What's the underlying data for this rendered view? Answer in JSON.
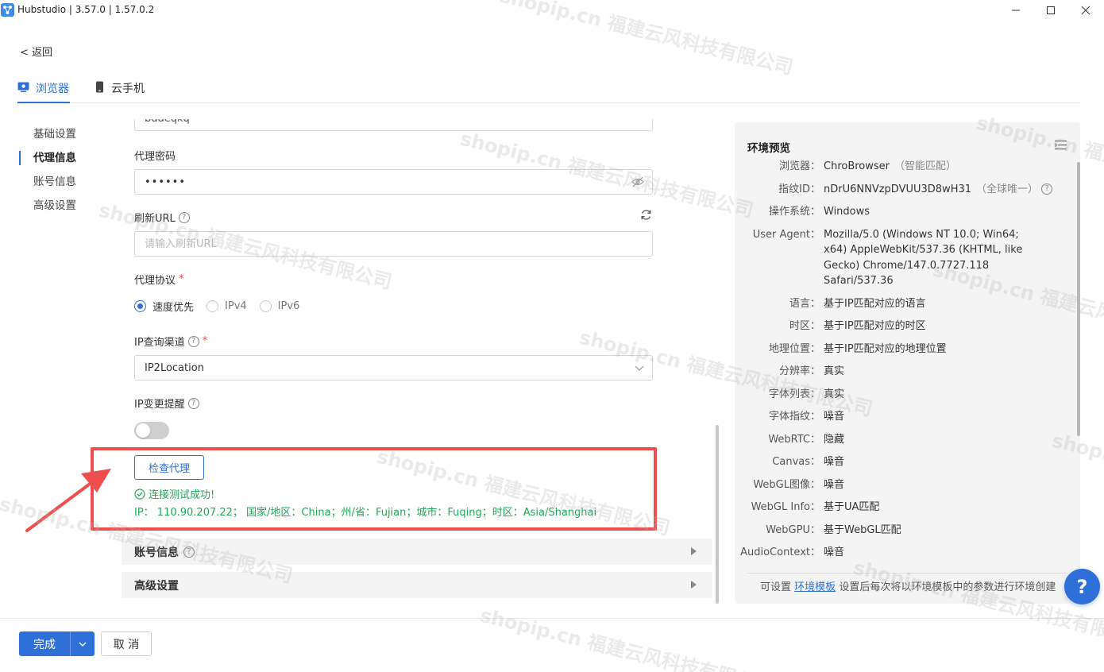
{
  "window": {
    "title": "Hubstudio | 3.57.0 | 1.57.0.2",
    "controls": [
      "minimize-icon",
      "maximize-icon",
      "close-icon"
    ]
  },
  "nav": {
    "back_label": "< 返回"
  },
  "tabs": [
    {
      "label": "浏览器",
      "icon": "browser-icon",
      "active": true
    },
    {
      "label": "云手机",
      "icon": "phone-icon",
      "active": false
    }
  ],
  "subnav": {
    "items": [
      {
        "label": "基础设置",
        "active": false
      },
      {
        "label": "代理信息",
        "active": true
      },
      {
        "label": "账号信息",
        "active": false
      },
      {
        "label": "高级设置",
        "active": false
      }
    ]
  },
  "form": {
    "username_partial": "bddeqkq",
    "proxy_password": {
      "label": "代理密码",
      "value": "••••••"
    },
    "refresh_url": {
      "label": "刷新URL",
      "placeholder": "请输入刷新URL"
    },
    "protocol": {
      "label": "代理协议",
      "required_mark": "*",
      "options": [
        {
          "label": "速度优先",
          "selected": true
        },
        {
          "label": "IPv4",
          "selected": false
        },
        {
          "label": "IPv6",
          "selected": false
        }
      ]
    },
    "ip_channel": {
      "label": "IP查询渠道",
      "required_mark": "*",
      "value": "IP2Location"
    },
    "ip_change_alert": {
      "label": "IP变更提醒",
      "enabled": false
    },
    "check_button_label": "检查代理",
    "success_text": "连接测试成功!",
    "ip_info": "IP： 110.90.207.22； 国家/地区：China；州/省：Fujian；城市：Fuqing；时区：Asia/Shanghai",
    "collapsed_sections": [
      {
        "label": "账号信息",
        "has_help": true
      },
      {
        "label": "高级设置",
        "has_help": false
      }
    ]
  },
  "env_preview": {
    "title": "环境预览",
    "rows": [
      {
        "label": "浏览器：",
        "value": "ChroBrowser",
        "sub": "（智能匹配）"
      },
      {
        "label": "指纹ID：",
        "value": "nDrU6NNVzpDVUU3D8wH31",
        "sub": "（全球唯一）",
        "has_help": true
      },
      {
        "label": "操作系统：",
        "value": "Windows"
      },
      {
        "label": "User Agent：",
        "value": "Mozilla/5.0 (Windows NT 10.0; Win64; x64) AppleWebKit/537.36 (KHTML, like Gecko) Chrome/147.0.7727.118 Safari/537.36"
      },
      {
        "label": "语言：",
        "value": "基于IP匹配对应的语言"
      },
      {
        "label": "时区：",
        "value": "基于IP匹配对应的时区"
      },
      {
        "label": "地理位置：",
        "value": "基于IP匹配对应的地理位置"
      },
      {
        "label": "分辨率：",
        "value": "真实"
      },
      {
        "label": "字体列表：",
        "value": "真实"
      },
      {
        "label": "字体指纹：",
        "value": "噪音"
      },
      {
        "label": "WebRTC：",
        "value": "隐藏"
      },
      {
        "label": "Canvas：",
        "value": "噪音"
      },
      {
        "label": "WebGL图像：",
        "value": "噪音"
      },
      {
        "label": "WebGL Info：",
        "value": "基于UA匹配"
      },
      {
        "label": "WebGPU：",
        "value": "基于WebGL匹配"
      },
      {
        "label": "AudioContext：",
        "value": "噪音"
      }
    ],
    "footer_prefix": "可设置",
    "footer_link": "环境模板",
    "footer_suffix": "设置后每次将以环境模板中的参数进行环境创建"
  },
  "help_button_label": "?",
  "bottom": {
    "done_label": "完成",
    "cancel_label": "取 消"
  },
  "watermark_text": "shopip.cn 福建云风科技有限公司",
  "colors": {
    "primary": "#2f6fd8",
    "success": "#1fa855",
    "highlight": "#f04e4e",
    "panel_bg": "#f4f4f5"
  }
}
